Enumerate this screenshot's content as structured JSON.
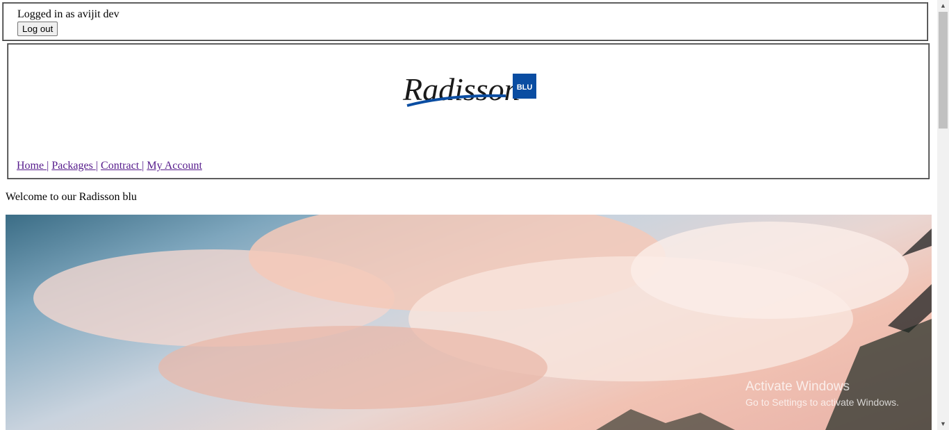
{
  "session": {
    "login_text": "Logged in as avijit dev",
    "logout_label": "Log out"
  },
  "header": {
    "logo_word": "Radisson",
    "logo_badge": "BLU"
  },
  "nav": {
    "items": [
      {
        "label": "Home "
      },
      {
        "label": "Packages "
      },
      {
        "label": "Contract "
      },
      {
        "label": "My Account"
      }
    ],
    "separator": "|"
  },
  "main": {
    "welcome_text": "Welcome to our Radisson blu"
  },
  "watermark": {
    "title": "Activate Windows",
    "subtitle": "Go to Settings to activate Windows."
  },
  "colors": {
    "brand_blue": "#0a4da2",
    "link_visited": "#551a8b"
  }
}
